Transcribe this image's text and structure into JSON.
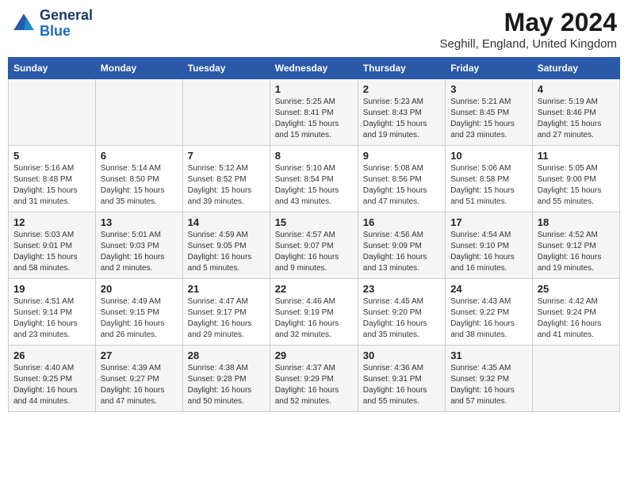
{
  "header": {
    "logo_line1": "General",
    "logo_line2": "Blue",
    "month_year": "May 2024",
    "location": "Seghill, England, United Kingdom"
  },
  "days_of_week": [
    "Sunday",
    "Monday",
    "Tuesday",
    "Wednesday",
    "Thursday",
    "Friday",
    "Saturday"
  ],
  "weeks": [
    [
      {
        "day": "",
        "info": ""
      },
      {
        "day": "",
        "info": ""
      },
      {
        "day": "",
        "info": ""
      },
      {
        "day": "1",
        "info": "Sunrise: 5:25 AM\nSunset: 8:41 PM\nDaylight: 15 hours\nand 15 minutes."
      },
      {
        "day": "2",
        "info": "Sunrise: 5:23 AM\nSunset: 8:43 PM\nDaylight: 15 hours\nand 19 minutes."
      },
      {
        "day": "3",
        "info": "Sunrise: 5:21 AM\nSunset: 8:45 PM\nDaylight: 15 hours\nand 23 minutes."
      },
      {
        "day": "4",
        "info": "Sunrise: 5:19 AM\nSunset: 8:46 PM\nDaylight: 15 hours\nand 27 minutes."
      }
    ],
    [
      {
        "day": "5",
        "info": "Sunrise: 5:16 AM\nSunset: 8:48 PM\nDaylight: 15 hours\nand 31 minutes."
      },
      {
        "day": "6",
        "info": "Sunrise: 5:14 AM\nSunset: 8:50 PM\nDaylight: 15 hours\nand 35 minutes."
      },
      {
        "day": "7",
        "info": "Sunrise: 5:12 AM\nSunset: 8:52 PM\nDaylight: 15 hours\nand 39 minutes."
      },
      {
        "day": "8",
        "info": "Sunrise: 5:10 AM\nSunset: 8:54 PM\nDaylight: 15 hours\nand 43 minutes."
      },
      {
        "day": "9",
        "info": "Sunrise: 5:08 AM\nSunset: 8:56 PM\nDaylight: 15 hours\nand 47 minutes."
      },
      {
        "day": "10",
        "info": "Sunrise: 5:06 AM\nSunset: 8:58 PM\nDaylight: 15 hours\nand 51 minutes."
      },
      {
        "day": "11",
        "info": "Sunrise: 5:05 AM\nSunset: 9:00 PM\nDaylight: 15 hours\nand 55 minutes."
      }
    ],
    [
      {
        "day": "12",
        "info": "Sunrise: 5:03 AM\nSunset: 9:01 PM\nDaylight: 15 hours\nand 58 minutes."
      },
      {
        "day": "13",
        "info": "Sunrise: 5:01 AM\nSunset: 9:03 PM\nDaylight: 16 hours\nand 2 minutes."
      },
      {
        "day": "14",
        "info": "Sunrise: 4:59 AM\nSunset: 9:05 PM\nDaylight: 16 hours\nand 5 minutes."
      },
      {
        "day": "15",
        "info": "Sunrise: 4:57 AM\nSunset: 9:07 PM\nDaylight: 16 hours\nand 9 minutes."
      },
      {
        "day": "16",
        "info": "Sunrise: 4:56 AM\nSunset: 9:09 PM\nDaylight: 16 hours\nand 13 minutes."
      },
      {
        "day": "17",
        "info": "Sunrise: 4:54 AM\nSunset: 9:10 PM\nDaylight: 16 hours\nand 16 minutes."
      },
      {
        "day": "18",
        "info": "Sunrise: 4:52 AM\nSunset: 9:12 PM\nDaylight: 16 hours\nand 19 minutes."
      }
    ],
    [
      {
        "day": "19",
        "info": "Sunrise: 4:51 AM\nSunset: 9:14 PM\nDaylight: 16 hours\nand 23 minutes."
      },
      {
        "day": "20",
        "info": "Sunrise: 4:49 AM\nSunset: 9:15 PM\nDaylight: 16 hours\nand 26 minutes."
      },
      {
        "day": "21",
        "info": "Sunrise: 4:47 AM\nSunset: 9:17 PM\nDaylight: 16 hours\nand 29 minutes."
      },
      {
        "day": "22",
        "info": "Sunrise: 4:46 AM\nSunset: 9:19 PM\nDaylight: 16 hours\nand 32 minutes."
      },
      {
        "day": "23",
        "info": "Sunrise: 4:45 AM\nSunset: 9:20 PM\nDaylight: 16 hours\nand 35 minutes."
      },
      {
        "day": "24",
        "info": "Sunrise: 4:43 AM\nSunset: 9:22 PM\nDaylight: 16 hours\nand 38 minutes."
      },
      {
        "day": "25",
        "info": "Sunrise: 4:42 AM\nSunset: 9:24 PM\nDaylight: 16 hours\nand 41 minutes."
      }
    ],
    [
      {
        "day": "26",
        "info": "Sunrise: 4:40 AM\nSunset: 9:25 PM\nDaylight: 16 hours\nand 44 minutes."
      },
      {
        "day": "27",
        "info": "Sunrise: 4:39 AM\nSunset: 9:27 PM\nDaylight: 16 hours\nand 47 minutes."
      },
      {
        "day": "28",
        "info": "Sunrise: 4:38 AM\nSunset: 9:28 PM\nDaylight: 16 hours\nand 50 minutes."
      },
      {
        "day": "29",
        "info": "Sunrise: 4:37 AM\nSunset: 9:29 PM\nDaylight: 16 hours\nand 52 minutes."
      },
      {
        "day": "30",
        "info": "Sunrise: 4:36 AM\nSunset: 9:31 PM\nDaylight: 16 hours\nand 55 minutes."
      },
      {
        "day": "31",
        "info": "Sunrise: 4:35 AM\nSunset: 9:32 PM\nDaylight: 16 hours\nand 57 minutes."
      },
      {
        "day": "",
        "info": ""
      }
    ]
  ]
}
